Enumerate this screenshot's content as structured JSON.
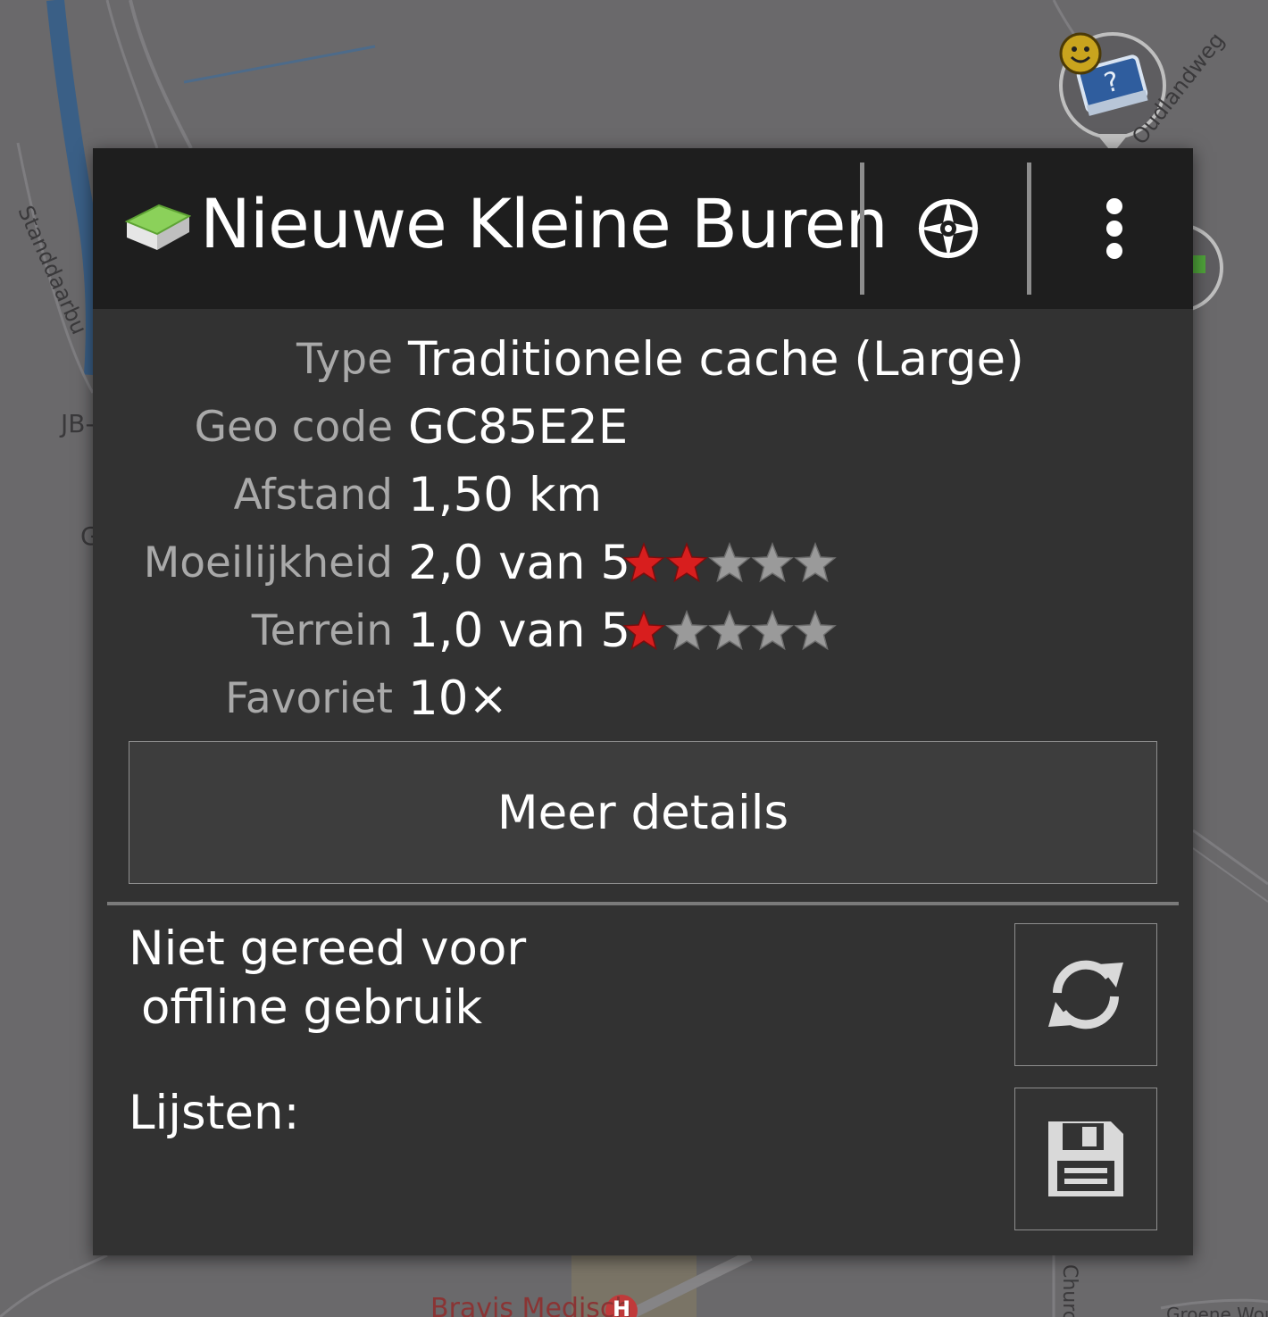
{
  "dialog": {
    "title": "Nieuwe Kleine Buren",
    "navigate_icon": "compass-icon",
    "menu_icon": "more-vert-icon",
    "cache_icon": "traditional-cache-icon"
  },
  "details": [
    {
      "label": "Type",
      "value": "Traditionele cache (Large)"
    },
    {
      "label": "Geo code",
      "value": "GC85E2E"
    },
    {
      "label": "Afstand",
      "value": "1,50 km"
    },
    {
      "label": "Moeilijkheid",
      "value": "2,0 van 5",
      "rating": 2.0,
      "rating_max": 5
    },
    {
      "label": "Terrein",
      "value": "1,0 van 5",
      "rating": 1.0,
      "rating_max": 5
    },
    {
      "label": "Favoriet",
      "value": "10×"
    }
  ],
  "more_details_label": "Meer details",
  "offline": {
    "line1": "Niet gereed voor",
    "line2": "offline gebruik",
    "refresh_icon": "refresh-icon"
  },
  "lists": {
    "label": "Lijsten:",
    "save_icon": "save-icon"
  },
  "map": {
    "street_labels": [
      "Standdaarbu",
      "Oudlandweg",
      "Church",
      "Groene Wou"
    ],
    "place_labels": [
      "JB-",
      "G",
      "Bravis Medisch"
    ],
    "hospital_marker": "H"
  },
  "colors": {
    "dialog_bg": "#323232",
    "titlebar_bg": "#1e1e1e",
    "star_filled": "#d81e1e",
    "star_empty": "#9a9a9a",
    "map_bg": "#6a696b"
  }
}
